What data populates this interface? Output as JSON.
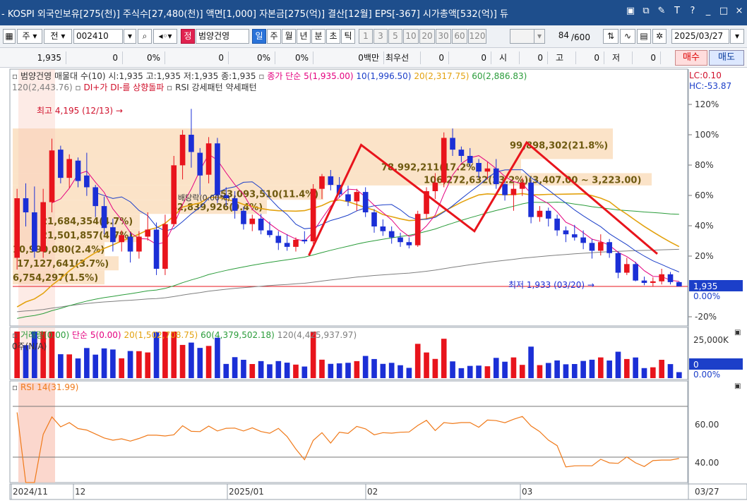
{
  "titlebar": {
    "text": "- KOSPI 외국인보유[275(천)] 주식수[27,480(천)] 액면[1,000] 자본금[275(억)] 결산[12월] EPS[-367] 시가총액[532(억)] 듀",
    "icons": [
      "layout-icon",
      "window-icon",
      "tool-icon",
      "font-icon",
      "help-icon",
      "minimize-icon",
      "maximize-icon",
      "close-icon"
    ]
  },
  "toolbar": {
    "mode_label": "주",
    "prev_label": "전",
    "code": "002410",
    "stock_badge": "정",
    "stock_name": "범양건영",
    "period_tabs": [
      "일",
      "주",
      "월",
      "년",
      "분",
      "초",
      "틱"
    ],
    "active_period": "일",
    "intervals": [
      "1",
      "3",
      "5",
      "10",
      "20",
      "30",
      "60",
      "120"
    ],
    "count": "84",
    "count_total": "/600",
    "date": "2025/03/27"
  },
  "quote": {
    "price": "1,935",
    "change": "0",
    "change_pct": "0%",
    "volume": "0",
    "volume_pct": "0%",
    "pct2": "0%",
    "amount": "0백만",
    "choise_label": "최우선",
    "v1": "0",
    "v2": "0",
    "open_label": "시",
    "open_val": "0",
    "high_label": "고",
    "high_val": "0",
    "low_label": "저",
    "low_val": "0",
    "buy_label": "매수",
    "sell_label": "매도"
  },
  "price_legend": {
    "line1": "범양건영 매물대 수(10)  시:1,935 고:1,935 저:1,935 종:1,935",
    "ma_title": "종가 단순 5(1,935.00)",
    "ma10": "10(1,996.50)",
    "ma20": "20(2,317.75)",
    "ma60": "60(2,886.83)",
    "ma120": "120(2,443.76)",
    "signal1": "DI+가 DI-를 상향돌파",
    "signal2": "RSI 강세패턴",
    "signal3": "약세패턴",
    "lc": "LC:0.10",
    "hc": "HC:-53.87"
  },
  "annotations": {
    "high": "최고 4,195 (12/13)",
    "low": "최저 1,933 (03/20)",
    "dividend": "배당락(0.00%)"
  },
  "volume_profile": [
    {
      "label": "99,898,302(21.8%)"
    },
    {
      "label": "78,992,211(17.2%)"
    },
    {
      "label": "106,272,632(23.2%)(3,407.00 ~ 3,223.00)"
    },
    {
      "label": "53,093,510(11.4%)"
    },
    {
      "label": "42,839,926(9.4%)"
    },
    {
      "label": "21,684,354(4.7%)"
    },
    {
      "label": "21,501,857(4.7%)"
    },
    {
      "label": "10,990,080(2.4%)"
    },
    {
      "label": "17,127,641(3.7%)"
    },
    {
      "label": "6,754,297(1.5%)"
    }
  ],
  "price_axis": {
    "ticks": [
      "120%",
      "100%",
      "80%",
      "60%",
      "40%",
      "20%",
      "0.00%",
      "-20%"
    ],
    "current": "1,935",
    "current_pct": "0.00%"
  },
  "volume_legend": {
    "title": "거래량(0.00)",
    "ma5": "단순 5(0.00)",
    "ma20": "20(1,502,708.75)",
    "ma60": "60(4,379,502.18)",
    "ma120": "120(4,425,937.97)",
    "unit": "0주(N/A)"
  },
  "volume_axis": {
    "tick": "25,000K",
    "current": "0",
    "current_pct": "0.00%"
  },
  "rsi_legend": {
    "title": "RSI 14(31.99)"
  },
  "rsi_axis": {
    "ticks": [
      "60.00",
      "40.00"
    ]
  },
  "date_axis": {
    "labels": [
      "2024/11",
      "12",
      "2025/01",
      "02",
      "03"
    ],
    "right_label": "03/27"
  },
  "colors": {
    "up": "#e8141c",
    "down": "#1b2fd6",
    "ma5": "#e4007f",
    "ma10": "#1c3fc9",
    "ma20": "#e3a20f",
    "ma60": "#2a9c3a",
    "ma120": "#7f7f7f",
    "rsi": "#f07a1a",
    "profile": "#fbe3c8",
    "highlight": "#f9c6b8"
  },
  "chart_data": {
    "type": "candlestick",
    "dates": [
      "2024/11",
      "12",
      "2025/01",
      "02",
      "03",
      "03/27"
    ],
    "current_price": 1935,
    "high": {
      "value": 4195,
      "date": "12/13"
    },
    "low": {
      "value": 1933,
      "date": "03/20"
    },
    "candles": [
      {
        "o": 2300,
        "h": 3180,
        "l": 2150,
        "c": 3060
      },
      {
        "o": 3060,
        "h": 3250,
        "l": 2700,
        "c": 2880
      },
      {
        "o": 2880,
        "h": 3210,
        "l": 2300,
        "c": 2380
      },
      {
        "o": 2380,
        "h": 3180,
        "l": 2300,
        "c": 3010
      },
      {
        "o": 3010,
        "h": 3820,
        "l": 2880,
        "c": 3670
      },
      {
        "o": 3680,
        "h": 3730,
        "l": 3250,
        "c": 3320
      },
      {
        "o": 3320,
        "h": 3620,
        "l": 3190,
        "c": 3560
      },
      {
        "o": 3540,
        "h": 3580,
        "l": 3200,
        "c": 3280
      },
      {
        "o": 3350,
        "h": 3640,
        "l": 3090,
        "c": 3200
      },
      {
        "o": 3200,
        "h": 3230,
        "l": 2820,
        "c": 2960
      },
      {
        "o": 2960,
        "h": 3080,
        "l": 2600,
        "c": 2680
      },
      {
        "o": 2690,
        "h": 2800,
        "l": 2380,
        "c": 2500
      },
      {
        "o": 2500,
        "h": 2650,
        "l": 2380,
        "c": 2590
      },
      {
        "o": 2570,
        "h": 2620,
        "l": 2240,
        "c": 2380
      },
      {
        "o": 2380,
        "h": 2640,
        "l": 2290,
        "c": 2570
      },
      {
        "o": 2570,
        "h": 2880,
        "l": 2520,
        "c": 2660
      },
      {
        "o": 2660,
        "h": 2750,
        "l": 2080,
        "c": 2160
      },
      {
        "o": 2160,
        "h": 2850,
        "l": 2080,
        "c": 2730
      },
      {
        "o": 2730,
        "h": 3600,
        "l": 2700,
        "c": 3480
      },
      {
        "o": 3480,
        "h": 3930,
        "l": 3300,
        "c": 3870
      },
      {
        "o": 3870,
        "h": 4200,
        "l": 3450,
        "c": 3650
      },
      {
        "o": 3640,
        "h": 3700,
        "l": 3100,
        "c": 3350
      },
      {
        "o": 3360,
        "h": 3840,
        "l": 3250,
        "c": 3760
      },
      {
        "o": 3760,
        "h": 3830,
        "l": 3000,
        "c": 3100
      },
      {
        "o": 3100,
        "h": 3200,
        "l": 2960,
        "c": 3060
      },
      {
        "o": 3060,
        "h": 3150,
        "l": 2800,
        "c": 2900
      },
      {
        "o": 2900,
        "h": 2950,
        "l": 2660,
        "c": 2730
      },
      {
        "o": 2730,
        "h": 2850,
        "l": 2640,
        "c": 2800
      },
      {
        "o": 2800,
        "h": 2860,
        "l": 2600,
        "c": 2650
      },
      {
        "o": 2650,
        "h": 2760,
        "l": 2560,
        "c": 2590
      },
      {
        "o": 2580,
        "h": 2640,
        "l": 2400,
        "c": 2490
      },
      {
        "o": 2490,
        "h": 2600,
        "l": 2390,
        "c": 2440
      },
      {
        "o": 2440,
        "h": 2560,
        "l": 2380,
        "c": 2530
      },
      {
        "o": 2530,
        "h": 2640,
        "l": 2480,
        "c": 2510
      },
      {
        "o": 2510,
        "h": 3240,
        "l": 2480,
        "c": 3180
      },
      {
        "o": 3180,
        "h": 3370,
        "l": 3050,
        "c": 3340
      },
      {
        "o": 3340,
        "h": 3420,
        "l": 3160,
        "c": 3230
      },
      {
        "o": 3230,
        "h": 3330,
        "l": 3070,
        "c": 3110
      },
      {
        "o": 3110,
        "h": 3220,
        "l": 2960,
        "c": 3020
      },
      {
        "o": 3020,
        "h": 3180,
        "l": 2900,
        "c": 3140
      },
      {
        "o": 3140,
        "h": 3200,
        "l": 2820,
        "c": 2880
      },
      {
        "o": 2880,
        "h": 2920,
        "l": 2620,
        "c": 2700
      },
      {
        "o": 2700,
        "h": 2790,
        "l": 2580,
        "c": 2640
      },
      {
        "o": 2640,
        "h": 2700,
        "l": 2480,
        "c": 2560
      },
      {
        "o": 2560,
        "h": 2620,
        "l": 2440,
        "c": 2500
      },
      {
        "o": 2500,
        "h": 2560,
        "l": 2420,
        "c": 2460
      },
      {
        "o": 2460,
        "h": 2900,
        "l": 2440,
        "c": 2860
      },
      {
        "o": 2860,
        "h": 3200,
        "l": 2800,
        "c": 3150
      },
      {
        "o": 3150,
        "h": 3380,
        "l": 3050,
        "c": 3260
      },
      {
        "o": 3260,
        "h": 3900,
        "l": 3200,
        "c": 3830
      },
      {
        "o": 3830,
        "h": 3950,
        "l": 3600,
        "c": 3680
      },
      {
        "o": 3680,
        "h": 3720,
        "l": 3520,
        "c": 3600
      },
      {
        "o": 3600,
        "h": 3700,
        "l": 3460,
        "c": 3510
      },
      {
        "o": 3510,
        "h": 3560,
        "l": 3320,
        "c": 3400
      },
      {
        "o": 3400,
        "h": 3520,
        "l": 3300,
        "c": 3440
      },
      {
        "o": 3440,
        "h": 3560,
        "l": 3180,
        "c": 3240
      },
      {
        "o": 3240,
        "h": 3320,
        "l": 3030,
        "c": 3100
      },
      {
        "o": 3100,
        "h": 3250,
        "l": 2900,
        "c": 3180
      },
      {
        "o": 3180,
        "h": 3320,
        "l": 3090,
        "c": 3260
      },
      {
        "o": 3260,
        "h": 3300,
        "l": 2740,
        "c": 2820
      },
      {
        "o": 2820,
        "h": 2960,
        "l": 2760,
        "c": 2900
      },
      {
        "o": 2900,
        "h": 2940,
        "l": 2700,
        "c": 2800
      },
      {
        "o": 2800,
        "h": 2850,
        "l": 2580,
        "c": 2650
      },
      {
        "o": 2650,
        "h": 2700,
        "l": 2500,
        "c": 2600
      },
      {
        "o": 2600,
        "h": 2720,
        "l": 2520,
        "c": 2560
      },
      {
        "o": 2560,
        "h": 2650,
        "l": 2410,
        "c": 2490
      },
      {
        "o": 2490,
        "h": 2540,
        "l": 2290,
        "c": 2390
      },
      {
        "o": 2390,
        "h": 2600,
        "l": 2330,
        "c": 2500
      },
      {
        "o": 2500,
        "h": 2540,
        "l": 2300,
        "c": 2360
      },
      {
        "o": 2360,
        "h": 2380,
        "l": 2040,
        "c": 2110
      },
      {
        "o": 2110,
        "h": 2300,
        "l": 2080,
        "c": 2220
      },
      {
        "o": 2220,
        "h": 2250,
        "l": 2000,
        "c": 2010
      },
      {
        "o": 2010,
        "h": 2060,
        "l": 1950,
        "c": 1980
      },
      {
        "o": 1980,
        "h": 2050,
        "l": 1933,
        "c": 2000
      },
      {
        "o": 2000,
        "h": 2160,
        "l": 1960,
        "c": 2090
      },
      {
        "o": 2090,
        "h": 2120,
        "l": 1960,
        "c": 1990
      },
      {
        "o": 1990,
        "h": 2000,
        "l": 1935,
        "c": 1935
      }
    ]
  }
}
